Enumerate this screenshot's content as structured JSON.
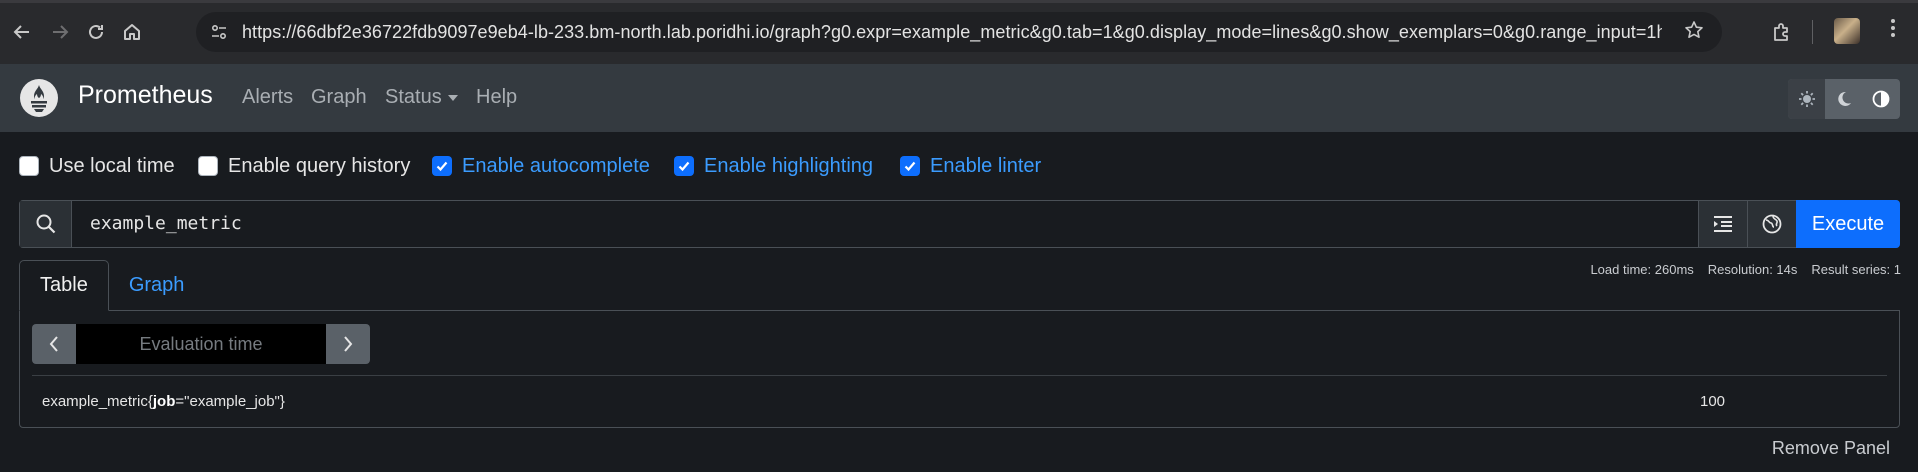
{
  "browser": {
    "url": "https://66dbf2e36722fdb9097e9eb4-lb-233.bm-north.lab.poridhi.io/graph?g0.expr=example_metric&g0.tab=1&g0.display_mode=lines&g0.show_exemplars=0&g0.range_input=1h",
    "icons": [
      "back-icon",
      "forward-icon",
      "reload-icon",
      "home-icon",
      "site-info-icon",
      "bookmark-star-icon",
      "extensions-icon",
      "profile-avatar",
      "menu-icon"
    ]
  },
  "navbar": {
    "brand": "Prometheus",
    "links": {
      "alerts": "Alerts",
      "graph": "Graph",
      "status": "Status",
      "help": "Help"
    },
    "theme_buttons": [
      "light-theme-icon",
      "dark-theme-icon",
      "auto-theme-icon"
    ]
  },
  "options": {
    "local_time": {
      "label": "Use local time",
      "checked": false
    },
    "query_history": {
      "label": "Enable query history",
      "checked": false
    },
    "autocomplete": {
      "label": "Enable autocomplete",
      "checked": true
    },
    "highlighting": {
      "label": "Enable highlighting",
      "checked": true
    },
    "linter": {
      "label": "Enable linter",
      "checked": true
    }
  },
  "expression": {
    "value": "example_metric",
    "execute_label": "Execute"
  },
  "stats": {
    "load_time": "Load time: 260ms",
    "resolution": "Resolution: 14s",
    "result_series": "Result series: 1"
  },
  "tabs": {
    "table": "Table",
    "graph": "Graph",
    "active": "Table"
  },
  "table": {
    "eval_placeholder": "Evaluation time",
    "rows": [
      {
        "metric_name": "example_metric",
        "label_key": "job",
        "label_value": "\"example_job\"",
        "value": "100"
      }
    ]
  },
  "remove_panel": "Remove Panel",
  "colors": {
    "accent": "#0d6efd",
    "link": "#3b9cff",
    "background": "#181b1f",
    "navbar": "#343a40"
  }
}
